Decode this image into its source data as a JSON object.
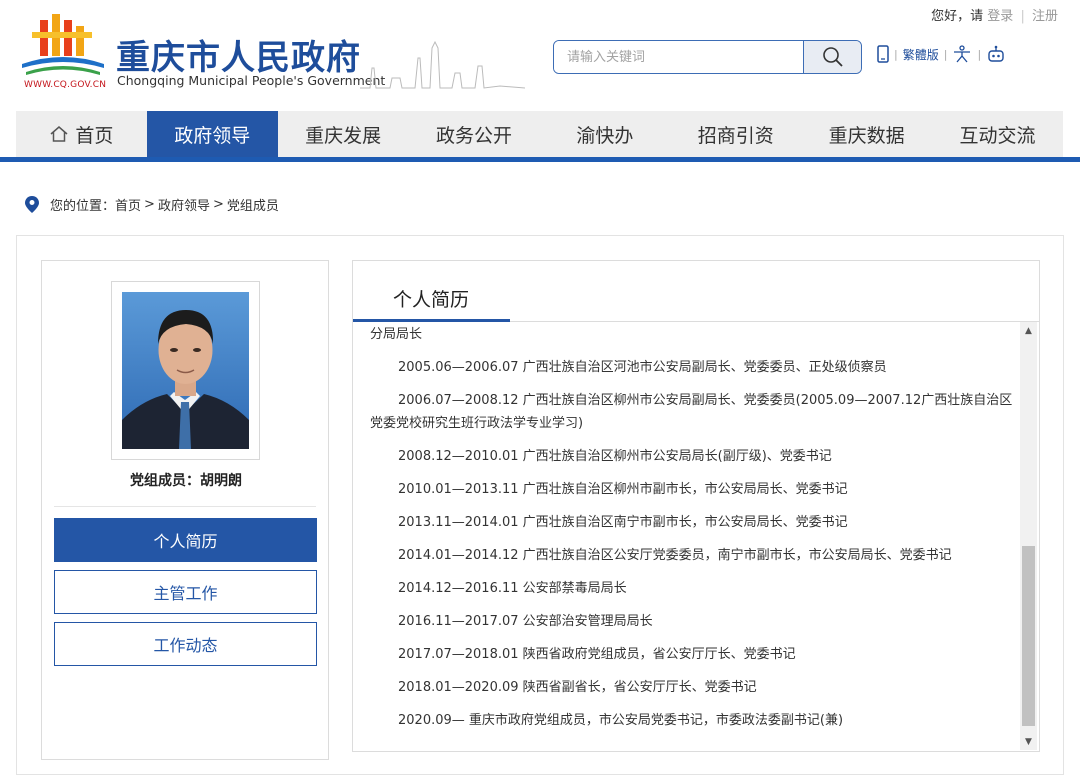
{
  "top": {
    "greeting": "您好，请",
    "login": "登录",
    "register": "注册"
  },
  "header": {
    "title_cn": "重庆市人民政府",
    "title_en": "Chongqing Municipal People's Government",
    "url": "WWW.CQ.GOV.CN",
    "search_placeholder": "请输入关键词",
    "traditional": "繁體版"
  },
  "nav": {
    "items": [
      {
        "label": "首页"
      },
      {
        "label": "政府领导"
      },
      {
        "label": "重庆发展"
      },
      {
        "label": "政务公开"
      },
      {
        "label": "渝快办"
      },
      {
        "label": "招商引资"
      },
      {
        "label": "重庆数据"
      },
      {
        "label": "互动交流"
      }
    ],
    "active_index": 1
  },
  "breadcrumb": {
    "prefix": "您的位置：",
    "items": [
      "首页",
      "政府领导",
      "党组成员"
    ],
    "separator": ">"
  },
  "profile": {
    "name_label": "党组成员：胡明朗",
    "buttons": [
      {
        "label": "个人简历"
      },
      {
        "label": "主管工作"
      },
      {
        "label": "工作动态"
      }
    ]
  },
  "bio": {
    "title": "个人简历",
    "lines": [
      "分局局长",
      "2005.06—2006.07 广西壮族自治区河池市公安局副局长、党委委员、正处级侦察员",
      "2006.07—2008.12 广西壮族自治区柳州市公安局副局长、党委委员(2005.09—2007.12广西壮族自治区党委党校研究生班行政法学专业学习)",
      "2008.12—2010.01 广西壮族自治区柳州市公安局局长(副厅级)、党委书记",
      "2010.01—2013.11 广西壮族自治区柳州市副市长，市公安局局长、党委书记",
      "2013.11—2014.01 广西壮族自治区南宁市副市长，市公安局局长、党委书记",
      "2014.01—2014.12 广西壮族自治区公安厅党委委员，南宁市副市长，市公安局局长、党委书记",
      "2014.12—2016.11 公安部禁毒局局长",
      "2016.11—2017.07 公安部治安管理局局长",
      "2017.07—2018.01 陕西省政府党组成员，省公安厅厅长、党委书记",
      "2018.01—2020.09 陕西省副省长，省公安厅厅长、党委书记",
      "2020.09— 重庆市政府党组成员，市公安局党委书记，市委政法委副书记(兼)"
    ]
  },
  "colors": {
    "primary": "#2456a6",
    "brand_text": "#1e4d9b",
    "nav_bg": "#eeeeee",
    "accent_red": "#c4161c"
  }
}
